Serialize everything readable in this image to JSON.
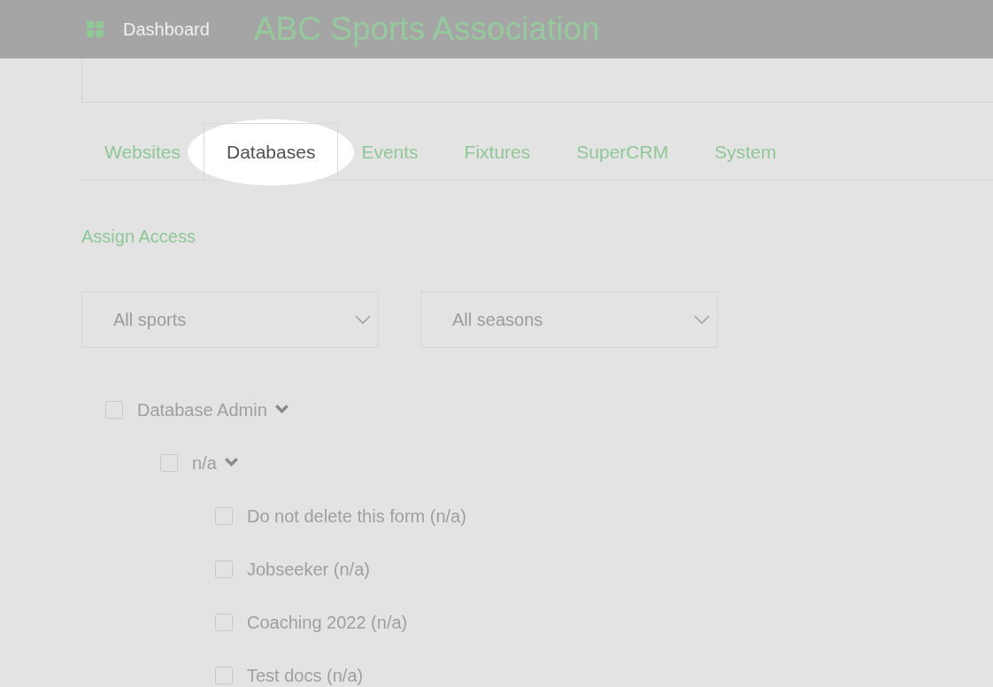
{
  "header": {
    "nav_link": "Dashboard",
    "title": "ABC Sports Association"
  },
  "tabs": [
    {
      "label": "Websites",
      "selected": false,
      "highlighted": false
    },
    {
      "label": "Databases",
      "selected": true,
      "highlighted": true
    },
    {
      "label": "Events",
      "selected": false,
      "highlighted": false
    },
    {
      "label": "Fixtures",
      "selected": false,
      "highlighted": false
    },
    {
      "label": "SuperCRM",
      "selected": false,
      "highlighted": false
    },
    {
      "label": "System",
      "selected": false,
      "highlighted": false
    }
  ],
  "section_link": "Assign Access",
  "filters": [
    {
      "value": "All sports"
    },
    {
      "value": "All seasons"
    }
  ],
  "access_tree": [
    {
      "label": "Database Admin",
      "checked": false,
      "expanded": true,
      "children": [
        {
          "label": "n/a",
          "checked": false,
          "expanded": true,
          "children": [
            {
              "label": "Do not delete this form (n/a)",
              "checked": false
            },
            {
              "label": "Jobseeker (n/a)",
              "checked": false
            },
            {
              "label": "Coaching 2022 (n/a)",
              "checked": false
            },
            {
              "label": "Test docs (n/a)",
              "checked": false
            }
          ]
        }
      ]
    }
  ]
}
